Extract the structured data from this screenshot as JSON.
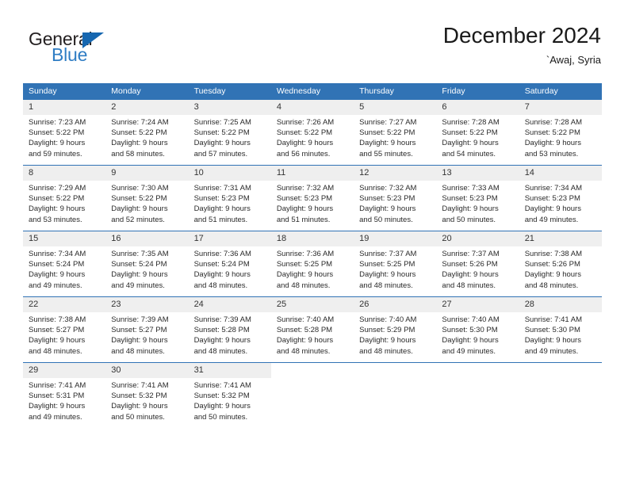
{
  "brand": {
    "name_top": "General",
    "name_bottom": "Blue",
    "accent_color": "#2f7dc4",
    "triangle_color": "#1667b0"
  },
  "header": {
    "title": "December 2024",
    "subtitle": "`Awaj, Syria"
  },
  "calendar": {
    "header_color": "#3173b5",
    "daynum_band_color": "#efefef",
    "weekdays": [
      "Sunday",
      "Monday",
      "Tuesday",
      "Wednesday",
      "Thursday",
      "Friday",
      "Saturday"
    ],
    "weeks": [
      [
        {
          "day": "1",
          "sunrise": "Sunrise: 7:23 AM",
          "sunset": "Sunset: 5:22 PM",
          "daylight_line1": "Daylight: 9 hours",
          "daylight_line2": "and 59 minutes."
        },
        {
          "day": "2",
          "sunrise": "Sunrise: 7:24 AM",
          "sunset": "Sunset: 5:22 PM",
          "daylight_line1": "Daylight: 9 hours",
          "daylight_line2": "and 58 minutes."
        },
        {
          "day": "3",
          "sunrise": "Sunrise: 7:25 AM",
          "sunset": "Sunset: 5:22 PM",
          "daylight_line1": "Daylight: 9 hours",
          "daylight_line2": "and 57 minutes."
        },
        {
          "day": "4",
          "sunrise": "Sunrise: 7:26 AM",
          "sunset": "Sunset: 5:22 PM",
          "daylight_line1": "Daylight: 9 hours",
          "daylight_line2": "and 56 minutes."
        },
        {
          "day": "5",
          "sunrise": "Sunrise: 7:27 AM",
          "sunset": "Sunset: 5:22 PM",
          "daylight_line1": "Daylight: 9 hours",
          "daylight_line2": "and 55 minutes."
        },
        {
          "day": "6",
          "sunrise": "Sunrise: 7:28 AM",
          "sunset": "Sunset: 5:22 PM",
          "daylight_line1": "Daylight: 9 hours",
          "daylight_line2": "and 54 minutes."
        },
        {
          "day": "7",
          "sunrise": "Sunrise: 7:28 AM",
          "sunset": "Sunset: 5:22 PM",
          "daylight_line1": "Daylight: 9 hours",
          "daylight_line2": "and 53 minutes."
        }
      ],
      [
        {
          "day": "8",
          "sunrise": "Sunrise: 7:29 AM",
          "sunset": "Sunset: 5:22 PM",
          "daylight_line1": "Daylight: 9 hours",
          "daylight_line2": "and 53 minutes."
        },
        {
          "day": "9",
          "sunrise": "Sunrise: 7:30 AM",
          "sunset": "Sunset: 5:22 PM",
          "daylight_line1": "Daylight: 9 hours",
          "daylight_line2": "and 52 minutes."
        },
        {
          "day": "10",
          "sunrise": "Sunrise: 7:31 AM",
          "sunset": "Sunset: 5:23 PM",
          "daylight_line1": "Daylight: 9 hours",
          "daylight_line2": "and 51 minutes."
        },
        {
          "day": "11",
          "sunrise": "Sunrise: 7:32 AM",
          "sunset": "Sunset: 5:23 PM",
          "daylight_line1": "Daylight: 9 hours",
          "daylight_line2": "and 51 minutes."
        },
        {
          "day": "12",
          "sunrise": "Sunrise: 7:32 AM",
          "sunset": "Sunset: 5:23 PM",
          "daylight_line1": "Daylight: 9 hours",
          "daylight_line2": "and 50 minutes."
        },
        {
          "day": "13",
          "sunrise": "Sunrise: 7:33 AM",
          "sunset": "Sunset: 5:23 PM",
          "daylight_line1": "Daylight: 9 hours",
          "daylight_line2": "and 50 minutes."
        },
        {
          "day": "14",
          "sunrise": "Sunrise: 7:34 AM",
          "sunset": "Sunset: 5:23 PM",
          "daylight_line1": "Daylight: 9 hours",
          "daylight_line2": "and 49 minutes."
        }
      ],
      [
        {
          "day": "15",
          "sunrise": "Sunrise: 7:34 AM",
          "sunset": "Sunset: 5:24 PM",
          "daylight_line1": "Daylight: 9 hours",
          "daylight_line2": "and 49 minutes."
        },
        {
          "day": "16",
          "sunrise": "Sunrise: 7:35 AM",
          "sunset": "Sunset: 5:24 PM",
          "daylight_line1": "Daylight: 9 hours",
          "daylight_line2": "and 49 minutes."
        },
        {
          "day": "17",
          "sunrise": "Sunrise: 7:36 AM",
          "sunset": "Sunset: 5:24 PM",
          "daylight_line1": "Daylight: 9 hours",
          "daylight_line2": "and 48 minutes."
        },
        {
          "day": "18",
          "sunrise": "Sunrise: 7:36 AM",
          "sunset": "Sunset: 5:25 PM",
          "daylight_line1": "Daylight: 9 hours",
          "daylight_line2": "and 48 minutes."
        },
        {
          "day": "19",
          "sunrise": "Sunrise: 7:37 AM",
          "sunset": "Sunset: 5:25 PM",
          "daylight_line1": "Daylight: 9 hours",
          "daylight_line2": "and 48 minutes."
        },
        {
          "day": "20",
          "sunrise": "Sunrise: 7:37 AM",
          "sunset": "Sunset: 5:26 PM",
          "daylight_line1": "Daylight: 9 hours",
          "daylight_line2": "and 48 minutes."
        },
        {
          "day": "21",
          "sunrise": "Sunrise: 7:38 AM",
          "sunset": "Sunset: 5:26 PM",
          "daylight_line1": "Daylight: 9 hours",
          "daylight_line2": "and 48 minutes."
        }
      ],
      [
        {
          "day": "22",
          "sunrise": "Sunrise: 7:38 AM",
          "sunset": "Sunset: 5:27 PM",
          "daylight_line1": "Daylight: 9 hours",
          "daylight_line2": "and 48 minutes."
        },
        {
          "day": "23",
          "sunrise": "Sunrise: 7:39 AM",
          "sunset": "Sunset: 5:27 PM",
          "daylight_line1": "Daylight: 9 hours",
          "daylight_line2": "and 48 minutes."
        },
        {
          "day": "24",
          "sunrise": "Sunrise: 7:39 AM",
          "sunset": "Sunset: 5:28 PM",
          "daylight_line1": "Daylight: 9 hours",
          "daylight_line2": "and 48 minutes."
        },
        {
          "day": "25",
          "sunrise": "Sunrise: 7:40 AM",
          "sunset": "Sunset: 5:28 PM",
          "daylight_line1": "Daylight: 9 hours",
          "daylight_line2": "and 48 minutes."
        },
        {
          "day": "26",
          "sunrise": "Sunrise: 7:40 AM",
          "sunset": "Sunset: 5:29 PM",
          "daylight_line1": "Daylight: 9 hours",
          "daylight_line2": "and 48 minutes."
        },
        {
          "day": "27",
          "sunrise": "Sunrise: 7:40 AM",
          "sunset": "Sunset: 5:30 PM",
          "daylight_line1": "Daylight: 9 hours",
          "daylight_line2": "and 49 minutes."
        },
        {
          "day": "28",
          "sunrise": "Sunrise: 7:41 AM",
          "sunset": "Sunset: 5:30 PM",
          "daylight_line1": "Daylight: 9 hours",
          "daylight_line2": "and 49 minutes."
        }
      ],
      [
        {
          "day": "29",
          "sunrise": "Sunrise: 7:41 AM",
          "sunset": "Sunset: 5:31 PM",
          "daylight_line1": "Daylight: 9 hours",
          "daylight_line2": "and 49 minutes."
        },
        {
          "day": "30",
          "sunrise": "Sunrise: 7:41 AM",
          "sunset": "Sunset: 5:32 PM",
          "daylight_line1": "Daylight: 9 hours",
          "daylight_line2": "and 50 minutes."
        },
        {
          "day": "31",
          "sunrise": "Sunrise: 7:41 AM",
          "sunset": "Sunset: 5:32 PM",
          "daylight_line1": "Daylight: 9 hours",
          "daylight_line2": "and 50 minutes."
        },
        {
          "day": "",
          "sunrise": "",
          "sunset": "",
          "daylight_line1": "",
          "daylight_line2": ""
        },
        {
          "day": "",
          "sunrise": "",
          "sunset": "",
          "daylight_line1": "",
          "daylight_line2": ""
        },
        {
          "day": "",
          "sunrise": "",
          "sunset": "",
          "daylight_line1": "",
          "daylight_line2": ""
        },
        {
          "day": "",
          "sunrise": "",
          "sunset": "",
          "daylight_line1": "",
          "daylight_line2": ""
        }
      ]
    ]
  }
}
